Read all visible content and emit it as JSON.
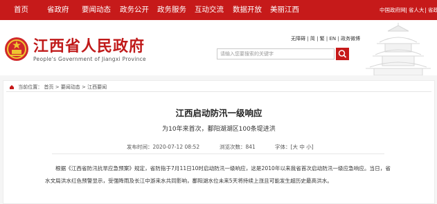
{
  "nav": {
    "items": [
      "首页",
      "省政府",
      "要闻动态",
      "政务公开",
      "政务服务",
      "互动交流",
      "数据开放",
      "美丽江西"
    ],
    "utility": [
      "中国政府网",
      "省人大",
      "省政协"
    ]
  },
  "header": {
    "title": "江西省人民政府",
    "subtitle": "People's Government of Jiangxi Province",
    "links": [
      "无障碍",
      "简",
      "繁",
      "EN",
      "政务微博"
    ],
    "search_placeholder": "请输入您要搜索的关键字"
  },
  "breadcrumb": {
    "label": "当前位置：",
    "items": [
      "首页",
      "要闻动态",
      "江西要闻"
    ]
  },
  "article": {
    "title": "江西启动防汛一级响应",
    "subtitle": "为10年来首次，鄱阳湖湖区100条堤进洪",
    "publish_label": "发布时间：",
    "publish_time": "2020-07-12 08:52",
    "views_label": "浏览次数：",
    "views": "841",
    "fontsize_label": "字体：",
    "fontsize_options": [
      "大",
      "中",
      "小"
    ],
    "body": "根据《江西省防汛抗旱应急预案》规定，省防指于7月11日10时启动防汛一级响应，这是2010年以来我省首次启动防汛一级应急响应。当日，省水文局洪水红色预警显示，受强降雨及长江中游来水共同影响，鄱阳湖水位未来5天将持续上涨且可能发生超历史最高洪水。"
  },
  "colors": {
    "brand_red": "#c61a1a"
  }
}
